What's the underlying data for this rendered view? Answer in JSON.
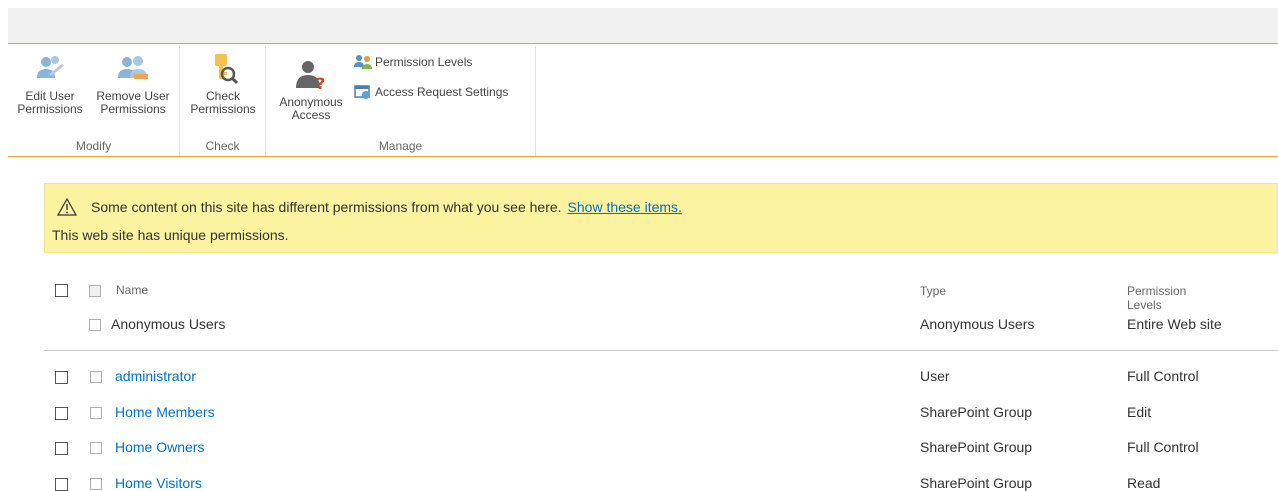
{
  "ribbon": {
    "groups": {
      "modify": {
        "label": "Modify",
        "edit_user_permissions": [
          "Edit User",
          "Permissions"
        ],
        "remove_user_permissions": [
          "Remove User",
          "Permissions"
        ]
      },
      "check": {
        "label": "Check",
        "check_permissions": [
          "Check",
          "Permissions"
        ]
      },
      "manage": {
        "label": "Manage",
        "anonymous_access": [
          "Anonymous",
          "Access"
        ],
        "permission_levels": "Permission Levels",
        "access_request_settings": "Access Request Settings"
      }
    }
  },
  "warning": {
    "message": "Some content on this site has different permissions from what you see here.",
    "link": "Show these items.",
    "unique": "This web site has unique permissions."
  },
  "table": {
    "headers": {
      "name": "Name",
      "type": "Type",
      "permission_levels": "Permission Levels"
    },
    "anonymous_row": {
      "name": "Anonymous Users",
      "type": "Anonymous Users",
      "level": "Entire Web site"
    },
    "rows": [
      {
        "name": "administrator",
        "type": "User",
        "level": "Full Control"
      },
      {
        "name": "Home Members",
        "type": "SharePoint Group",
        "level": "Edit"
      },
      {
        "name": "Home Owners",
        "type": "SharePoint Group",
        "level": "Full Control"
      },
      {
        "name": "Home Visitors",
        "type": "SharePoint Group",
        "level": "Read"
      }
    ]
  },
  "colors": {
    "accent": "#f0a030",
    "link": "#0072c6",
    "warning_bg": "#fcf3a0"
  }
}
